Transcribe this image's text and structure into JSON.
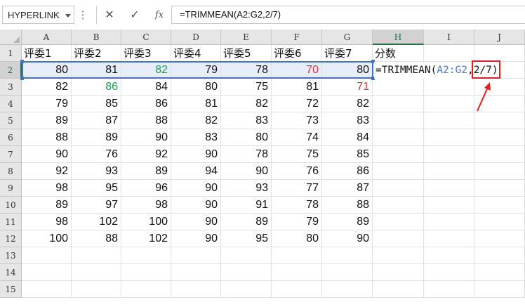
{
  "namebox": {
    "value": "HYPERLINK"
  },
  "formula_bar": {
    "cancel_icon": "✕",
    "confirm_icon": "✓",
    "fx_label": "fx",
    "formula": "=TRIMMEAN(A2:G2,2/7)"
  },
  "columns": [
    "A",
    "B",
    "C",
    "D",
    "E",
    "F",
    "G",
    "H",
    "I",
    "J"
  ],
  "rows": [
    "1",
    "2",
    "3",
    "4",
    "5",
    "6",
    "7",
    "8",
    "9",
    "10",
    "11",
    "12",
    "13",
    "14",
    "15"
  ],
  "header_row": [
    "评委1",
    "评委2",
    "评委3",
    "评委4",
    "评委5",
    "评委6",
    "评委7",
    "分数"
  ],
  "data": [
    [
      80,
      81,
      82,
      79,
      78,
      70,
      80
    ],
    [
      82,
      86,
      84,
      80,
      75,
      81,
      71
    ],
    [
      79,
      85,
      86,
      81,
      82,
      72,
      82
    ],
    [
      89,
      87,
      88,
      82,
      83,
      73,
      83
    ],
    [
      88,
      89,
      90,
      83,
      80,
      74,
      84
    ],
    [
      90,
      76,
      92,
      90,
      78,
      75,
      85
    ],
    [
      92,
      93,
      89,
      94,
      90,
      76,
      86
    ],
    [
      98,
      95,
      96,
      90,
      93,
      77,
      87
    ],
    [
      89,
      97,
      98,
      90,
      91,
      78,
      88
    ],
    [
      98,
      102,
      100,
      90,
      89,
      79,
      89
    ],
    [
      100,
      88,
      102,
      90,
      95,
      80,
      90
    ]
  ],
  "green_cells": [
    [
      0,
      2
    ],
    [
      1,
      1
    ]
  ],
  "red_cells": [
    [
      0,
      5
    ],
    [
      1,
      6
    ]
  ],
  "editing_cell": {
    "prefix": "=TRIMMEAN(",
    "range_ref": "A2:G2",
    "comma": ",",
    "highlight": "2/7)"
  },
  "colors": {
    "accent_green": "#217346",
    "range_blue": "#4472c4",
    "annotation_red": "#e02020"
  }
}
